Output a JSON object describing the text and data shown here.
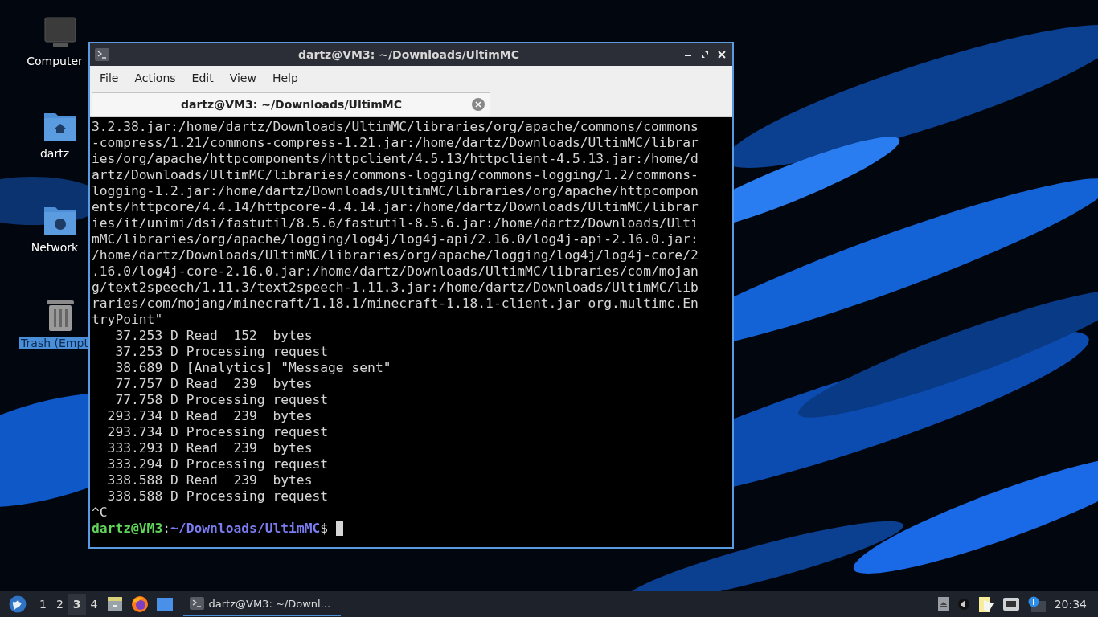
{
  "desktop_icons": [
    {
      "kind": "computer",
      "label": "Computer",
      "selected": false
    },
    {
      "kind": "home",
      "label": "dartz",
      "selected": false
    },
    {
      "kind": "network",
      "label": "Network",
      "selected": false
    },
    {
      "kind": "trash",
      "label": "Trash (Empt",
      "selected": true
    }
  ],
  "window": {
    "title": "dartz@VM3: ~/Downloads/UltimMC",
    "menu": [
      "File",
      "Actions",
      "Edit",
      "View",
      "Help"
    ],
    "tabs": [
      {
        "label": "dartz@VM3: ~/Downloads/UltimMC",
        "selected": true
      }
    ],
    "terminal_lines": [
      {
        "kind": "text",
        "text": "3.2.38.jar:/home/dartz/Downloads/UltimMC/libraries/org/apache/commons/commons"
      },
      {
        "kind": "text",
        "text": "-compress/1.21/commons-compress-1.21.jar:/home/dartz/Downloads/UltimMC/librar"
      },
      {
        "kind": "text",
        "text": "ies/org/apache/httpcomponents/httpclient/4.5.13/httpclient-4.5.13.jar:/home/d"
      },
      {
        "kind": "text",
        "text": "artz/Downloads/UltimMC/libraries/commons-logging/commons-logging/1.2/commons-"
      },
      {
        "kind": "text",
        "text": "logging-1.2.jar:/home/dartz/Downloads/UltimMC/libraries/org/apache/httpcompon"
      },
      {
        "kind": "text",
        "text": "ents/httpcore/4.4.14/httpcore-4.4.14.jar:/home/dartz/Downloads/UltimMC/librar"
      },
      {
        "kind": "text",
        "text": "ies/it/unimi/dsi/fastutil/8.5.6/fastutil-8.5.6.jar:/home/dartz/Downloads/Ulti"
      },
      {
        "kind": "text",
        "text": "mMC/libraries/org/apache/logging/log4j/log4j-api/2.16.0/log4j-api-2.16.0.jar:"
      },
      {
        "kind": "text",
        "text": "/home/dartz/Downloads/UltimMC/libraries/org/apache/logging/log4j/log4j-core/2"
      },
      {
        "kind": "text",
        "text": ".16.0/log4j-core-2.16.0.jar:/home/dartz/Downloads/UltimMC/libraries/com/mojan"
      },
      {
        "kind": "text",
        "text": "g/text2speech/1.11.3/text2speech-1.11.3.jar:/home/dartz/Downloads/UltimMC/lib"
      },
      {
        "kind": "text",
        "text": "raries/com/mojang/minecraft/1.18.1/minecraft-1.18.1-client.jar org.multimc.En"
      },
      {
        "kind": "text",
        "text": "tryPoint\""
      },
      {
        "kind": "text",
        "text": "   37.253 D Read  152  bytes"
      },
      {
        "kind": "text",
        "text": "   37.253 D Processing request"
      },
      {
        "kind": "text",
        "text": "   38.689 D [Analytics] \"Message sent\""
      },
      {
        "kind": "text",
        "text": "   77.757 D Read  239  bytes"
      },
      {
        "kind": "text",
        "text": "   77.758 D Processing request"
      },
      {
        "kind": "text",
        "text": "  293.734 D Read  239  bytes"
      },
      {
        "kind": "text",
        "text": "  293.734 D Processing request"
      },
      {
        "kind": "text",
        "text": "  333.293 D Read  239  bytes"
      },
      {
        "kind": "text",
        "text": "  333.294 D Processing request"
      },
      {
        "kind": "text",
        "text": "  338.588 D Read  239  bytes"
      },
      {
        "kind": "text",
        "text": "  338.588 D Processing request"
      },
      {
        "kind": "text",
        "text": "^C"
      },
      {
        "kind": "prompt",
        "user_host": "dartz@VM3",
        "separator": ":",
        "path": "~/Downloads/UltimMC",
        "symbol": "$"
      }
    ]
  },
  "taskbar": {
    "workspaces": [
      {
        "label": "1",
        "selected": false
      },
      {
        "label": "2",
        "selected": false
      },
      {
        "label": "3",
        "selected": true
      },
      {
        "label": "4",
        "selected": false
      }
    ],
    "tasks": [
      {
        "label": "dartz@VM3: ~/Downl...",
        "selected": true
      }
    ],
    "clock": "20:34"
  }
}
